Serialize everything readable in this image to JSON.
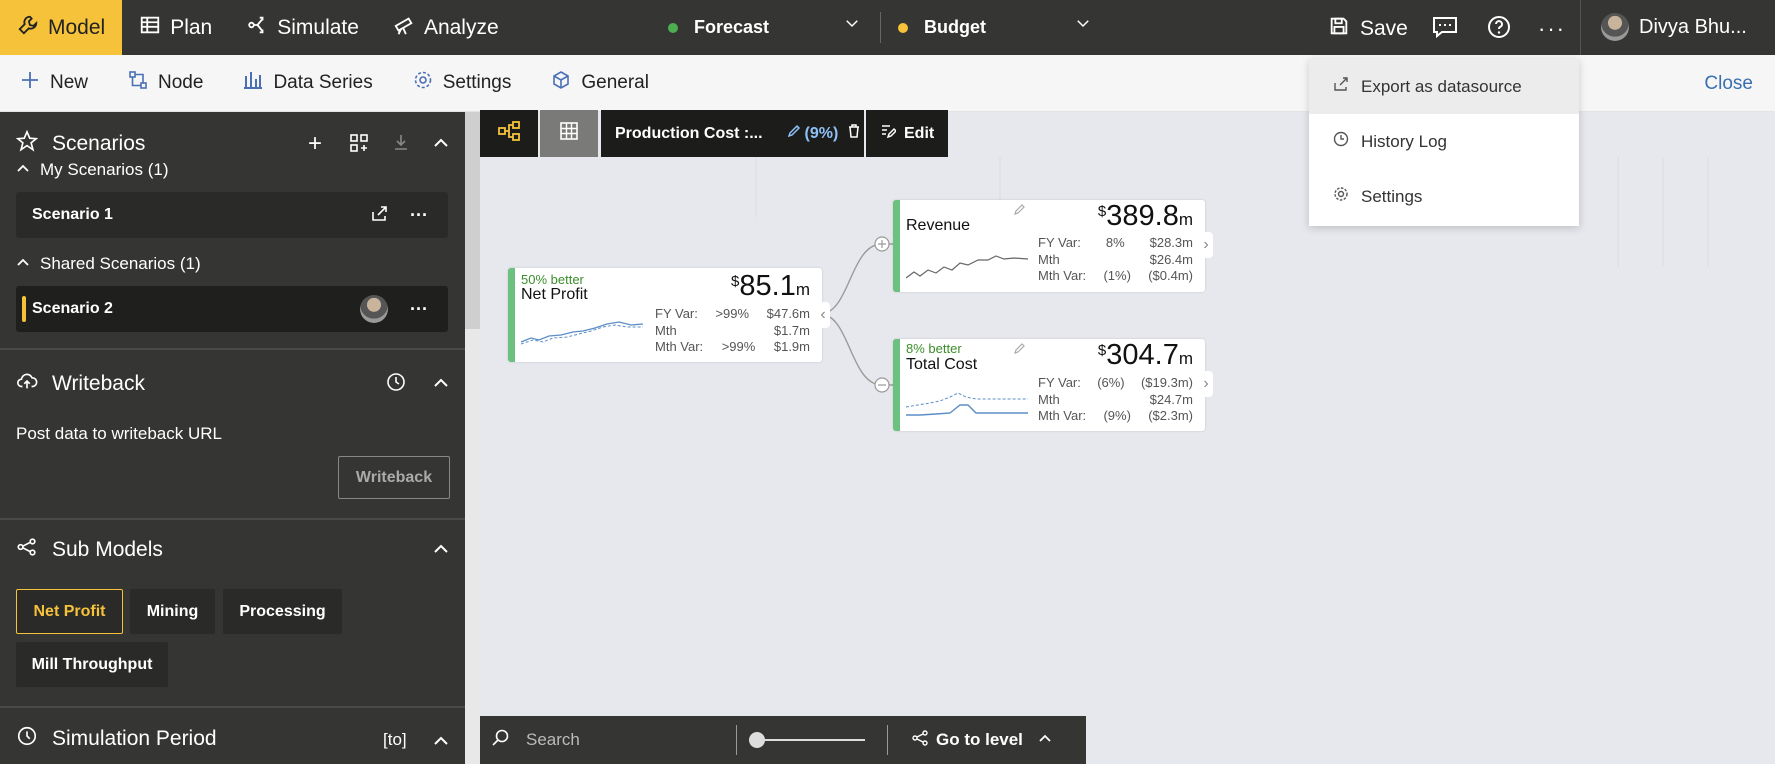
{
  "topbar": {
    "tabs": [
      {
        "label": "Model",
        "icon": "wrench-icon"
      },
      {
        "label": "Plan",
        "icon": "table-icon"
      },
      {
        "label": "Simulate",
        "icon": "fork-icon"
      },
      {
        "label": "Analyze",
        "icon": "telescope-icon"
      }
    ],
    "scenario_a": "Forecast",
    "scenario_a_color": "#4caf50",
    "scenario_b": "Budget",
    "scenario_b_color": "#f5c23a",
    "save_label": "Save",
    "user_name": "Divya Bhu...",
    "accent": "#f5c23a"
  },
  "subbar": {
    "items": [
      "New",
      "Node",
      "Data Series",
      "Settings",
      "General"
    ],
    "close_label": "Close"
  },
  "sidebar": {
    "scenarios_title": "Scenarios",
    "my_scenarios": "My Scenarios (1)",
    "scenario1": "Scenario 1",
    "shared_scenarios": "Shared Scenarios (1)",
    "scenario2": "Scenario 2",
    "writeback_title": "Writeback",
    "writeback_text": "Post data to writeback URL",
    "writeback_button": "Writeback",
    "submodels_title": "Sub Models",
    "chips": [
      "Net Profit",
      "Mining",
      "Processing",
      "Mill Throughput"
    ],
    "simulation_title": "Simulation Period",
    "simulation_value": "[to]"
  },
  "canvas_toolbar": {
    "filter_label": "Production Cost :...",
    "filter_value": "(9%)",
    "edit_label": "Edit"
  },
  "cards": {
    "net_profit": {
      "better": "50% better",
      "title": "Net Profit",
      "currency": "$",
      "value": "85.1",
      "unit": "m",
      "stats": [
        [
          "FY Var:",
          ">99%",
          "$47.6m"
        ],
        [
          "Mth",
          "",
          "$1.7m"
        ],
        [
          "Mth Var:",
          ">99%",
          "$1.9m"
        ]
      ]
    },
    "revenue": {
      "better": "",
      "title": "Revenue",
      "currency": "$",
      "value": "389.8",
      "unit": "m",
      "stats": [
        [
          "FY Var:",
          "8%",
          "$28.3m"
        ],
        [
          "Mth",
          "",
          "$26.4m"
        ],
        [
          "Mth Var:",
          "(1%)",
          "($0.4m)"
        ]
      ]
    },
    "total_cost": {
      "better": "8% better",
      "title": "Total Cost",
      "currency": "$",
      "value": "304.7",
      "unit": "m",
      "stats": [
        [
          "FY Var:",
          "(6%)",
          "($19.3m)"
        ],
        [
          "Mth",
          "",
          "$24.7m"
        ],
        [
          "Mth Var:",
          "(9%)",
          "($2.3m)"
        ]
      ]
    }
  },
  "dropdown": {
    "items": [
      "Export as datasource",
      "History Log",
      "Settings"
    ]
  },
  "bottombar": {
    "search_placeholder": "Search",
    "goto_label": "Go to level"
  }
}
